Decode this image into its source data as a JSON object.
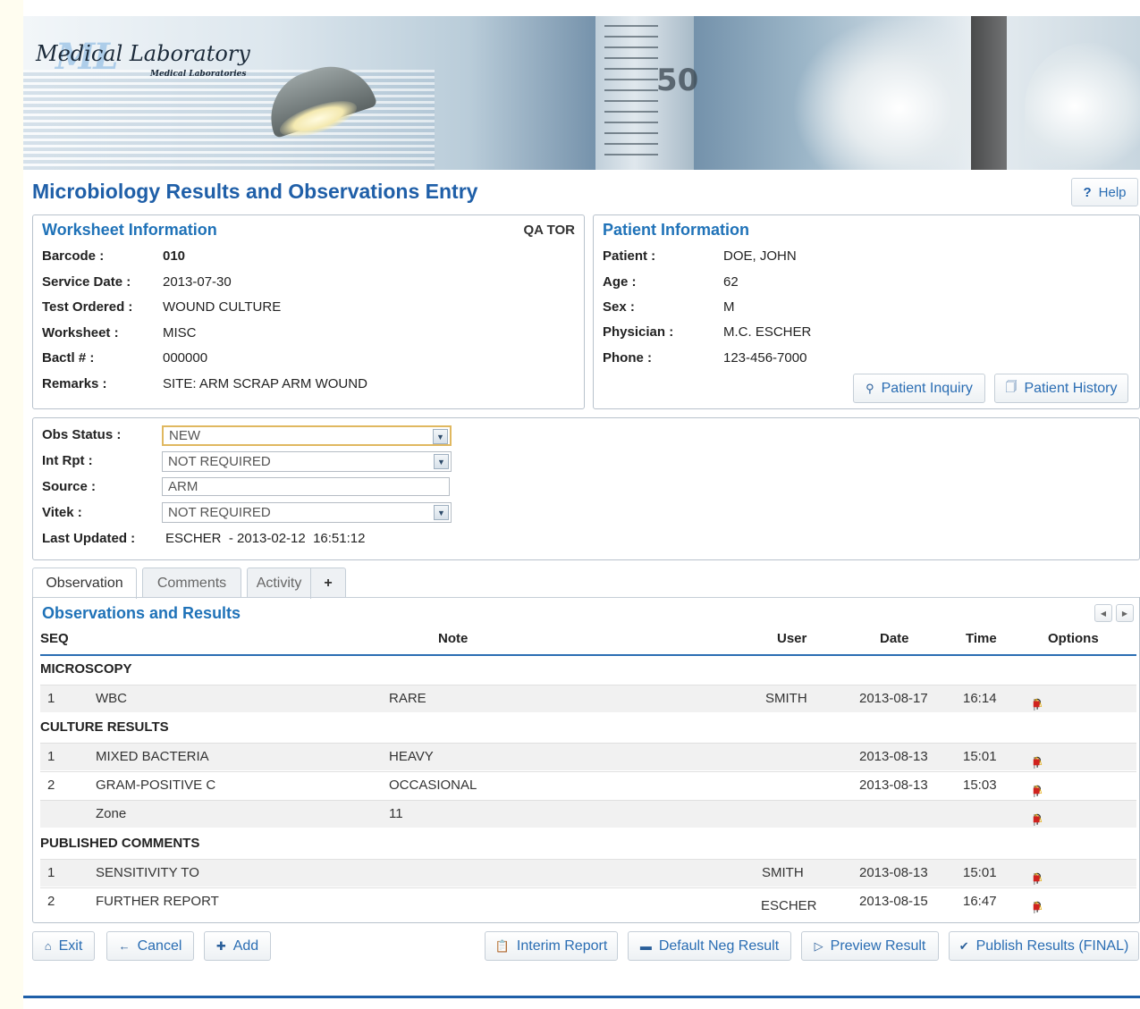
{
  "logo": {
    "mark": "ML",
    "title": "Medical Laboratory",
    "subtitle": "Medical Laboratories"
  },
  "banner_text": "50",
  "page_title": "Microbiology Results and Observations Entry",
  "help": {
    "label": "Help"
  },
  "worksheet": {
    "heading": "Worksheet Information",
    "tag": "QA TOR",
    "fields": [
      {
        "label": "Barcode :",
        "value": "010"
      },
      {
        "label": "Service Date :",
        "value": "2013-07-30"
      },
      {
        "label": "Test Ordered :",
        "value": "WOUND CULTURE"
      },
      {
        "label": "Worksheet :",
        "value": "MISC"
      },
      {
        "label": "Bactl # :",
        "value": "000000"
      },
      {
        "label": "Remarks :",
        "value": "SITE: ARM SCRAP ARM WOUND"
      }
    ]
  },
  "patient": {
    "heading": "Patient Information",
    "fields": [
      {
        "label": "Patient :",
        "value": "DOE, JOHN"
      },
      {
        "label": "Age :",
        "value": "62"
      },
      {
        "label": "Sex :",
        "value": "M"
      },
      {
        "label": "Physician :",
        "value": "M.C. ESCHER"
      },
      {
        "label": "Phone :",
        "value": "123-456-7000"
      }
    ],
    "inquiry_button": "Patient Inquiry",
    "history_button": "Patient History"
  },
  "status": {
    "obs_status": {
      "label": "Obs Status :",
      "value": "NEW"
    },
    "int_rpt": {
      "label": "Int Rpt :",
      "value": "NOT REQUIRED"
    },
    "source": {
      "label": "Source :",
      "value": "ARM"
    },
    "vitek": {
      "label": "Vitek :",
      "value": "NOT REQUIRED"
    },
    "last_updated": {
      "label": "Last Updated :",
      "value": "ESCHER  - 2013-02-12  16:51:12"
    }
  },
  "tabs": [
    "Observation",
    "Comments",
    "Activity",
    "+"
  ],
  "observations": {
    "heading": "Observations and Results",
    "columns": {
      "seq": "SEQ",
      "note": "Note",
      "user": "User",
      "date": "Date",
      "time": "Time",
      "options": "Options"
    },
    "groups": [
      {
        "name": "MICROSCOPY",
        "rows": [
          {
            "seq": "1",
            "item": "WBC",
            "note": "RARE",
            "user": "SMITH",
            "date": "2013-08-17",
            "time": "16:14"
          }
        ]
      },
      {
        "name": "CULTURE RESULTS",
        "rows": [
          {
            "seq": "1",
            "item": "MIXED BACTERIA",
            "note": "HEAVY",
            "user": "",
            "date": "2013-08-13",
            "time": "15:01"
          },
          {
            "seq": "2",
            "item": "GRAM-POSITIVE C",
            "note": "OCCASIONAL",
            "user": "",
            "date": "2013-08-13",
            "time": "15:03"
          },
          {
            "seq": "",
            "item": "Zone",
            "note": "11",
            "user": "",
            "date": "",
            "time": ""
          }
        ]
      },
      {
        "name": "PUBLISHED COMMENTS",
        "rows": [
          {
            "seq": "1",
            "item": "SENSITIVITY TO",
            "note": "",
            "user": "SMITH",
            "date": "2013-08-13",
            "time": "15:01"
          },
          {
            "seq": "2",
            "item": "FURTHER REPORT",
            "note": "",
            "user": "ESCHER",
            "date": "2013-08-15",
            "time": "16:47"
          }
        ]
      }
    ]
  },
  "actions": {
    "exit": "Exit",
    "cancel": "Cancel",
    "add": "Add",
    "interim": "Interim Report",
    "default_neg": "Default Neg Result",
    "preview": "Preview Result",
    "publish": "Publish Results (FINAL)"
  },
  "colors": {
    "title": "#1f5fa8",
    "heading": "#1f72b8",
    "accent": "#2a6db3",
    "delete": "#d0221f",
    "edit": "#e3a600"
  }
}
